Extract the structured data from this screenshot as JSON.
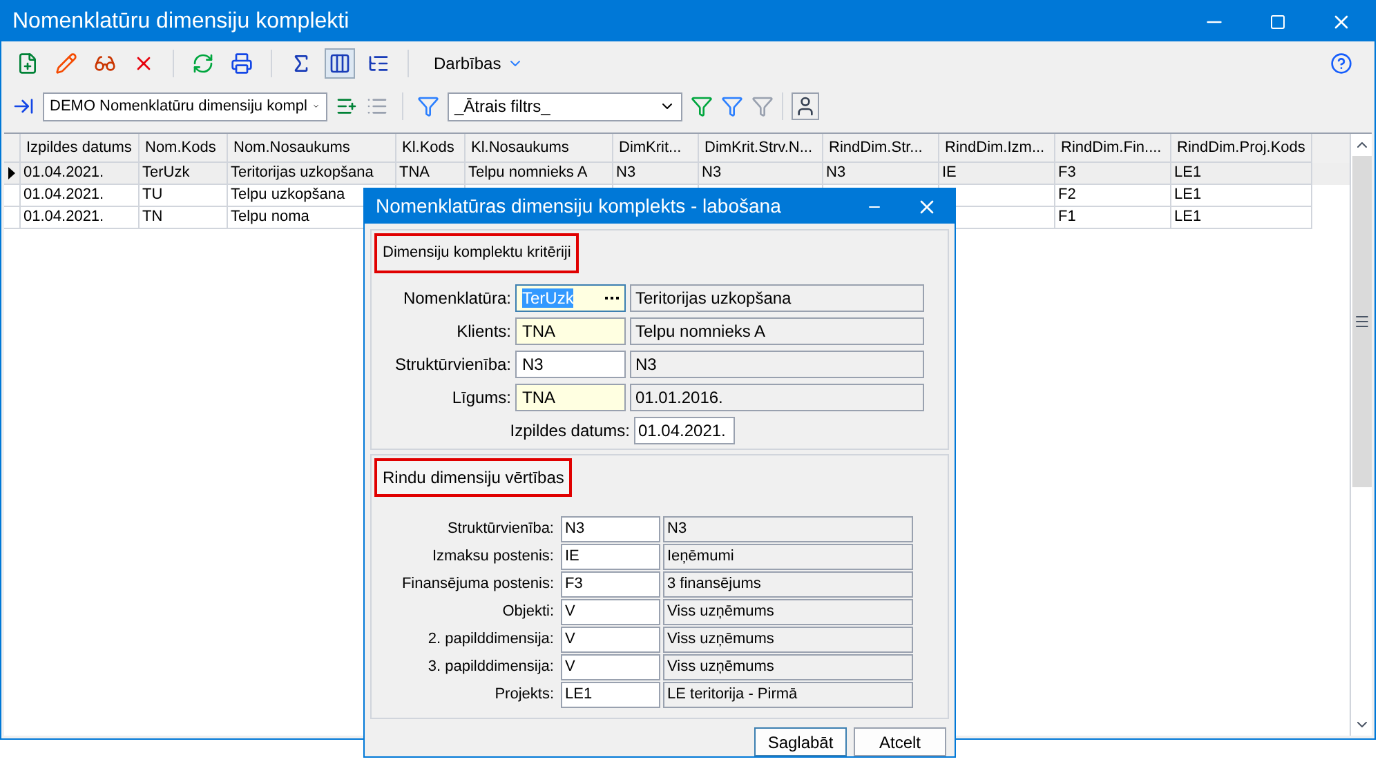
{
  "window": {
    "title": "Nomenklatūru dimensiju komplekti"
  },
  "toolbar": {
    "buttons": [
      {
        "kind": "new",
        "pressed": false
      },
      {
        "kind": "edit",
        "pressed": false
      },
      {
        "kind": "view",
        "pressed": false
      },
      {
        "kind": "delete",
        "pressed": false
      },
      {
        "kind": "sep"
      },
      {
        "kind": "refresh",
        "pressed": false
      },
      {
        "kind": "print",
        "pressed": false
      },
      {
        "kind": "sep"
      },
      {
        "kind": "sum",
        "pressed": false
      },
      {
        "kind": "columns",
        "pressed": true
      },
      {
        "kind": "tree",
        "pressed": false
      },
      {
        "kind": "sep"
      }
    ],
    "menu": "Darbības"
  },
  "filter_bar": {
    "layout": "DEMO Nomenklatūru dimensiju kompl",
    "quick_filter": "_Ātrais filtrs_"
  },
  "table": {
    "columns": [
      "Izpildes datums",
      "Nom.Kods",
      "Nom.Nosaukums",
      "Kl.Kods",
      "Kl.Nosaukums",
      "DimKrit...",
      "DimKrit.Strv.N...",
      "RindDim.Str...",
      "RindDim.Izm...",
      "RindDim.Fin....",
      "RindDim.Proj.Kods"
    ],
    "rows": [
      {
        "selected": true,
        "cells": [
          "01.04.2021.",
          "TerUzk",
          "Teritorijas uzkopšana",
          "TNA",
          "Telpu nomnieks A",
          "N3",
          "N3",
          "N3",
          "IE",
          "F3",
          "LE1"
        ]
      },
      {
        "selected": false,
        "cells": [
          "01.04.2021.",
          "TU",
          "Telpu uzkopšana",
          null,
          null,
          null,
          null,
          null,
          null,
          "F2",
          "LE1"
        ]
      },
      {
        "selected": false,
        "cells": [
          "01.04.2021.",
          "TN",
          "Telpu noma",
          null,
          null,
          null,
          null,
          null,
          null,
          "F1",
          "LE1"
        ]
      }
    ]
  },
  "dialog": {
    "title": "Nomenklatūras dimensiju komplekts - labošana",
    "section_1": {
      "title": "Dimensiju komplektu kritēriji",
      "fields": [
        {
          "label": "Nomenklatūra:",
          "code": "TerUzk",
          "name": "Teritorijas uzkopšana",
          "required": true,
          "focused": true
        },
        {
          "label": "Klients:",
          "code": "TNA",
          "name": "Telpu nomnieks A",
          "required": true,
          "focused": false
        },
        {
          "label": "Struktūrvienība:",
          "code": "N3",
          "name": "N3",
          "required": false,
          "focused": false
        },
        {
          "label": "Līgums:",
          "code": "TNA",
          "name": "01.01.2016.",
          "required": true,
          "focused": false
        }
      ],
      "date_label": "Izpildes datums:",
      "date": "01.04.2021."
    },
    "section_2": {
      "title": "Rindu dimensiju vērtības",
      "fields": [
        {
          "label": "Struktūrvienība:",
          "code": "N3",
          "name": "N3"
        },
        {
          "label": "Izmaksu postenis:",
          "code": "IE",
          "name": "Ieņēmumi"
        },
        {
          "label": "Finansējuma postenis:",
          "code": "F3",
          "name": "3 finansējums"
        },
        {
          "label": "Objekti:",
          "code": "V",
          "name": "Viss uzņēmums"
        },
        {
          "label": "2. papilddimensija:",
          "code": "V",
          "name": "Viss uzņēmums"
        },
        {
          "label": "3. papilddimensija:",
          "code": "V",
          "name": "Viss uzņēmums"
        },
        {
          "label": "Projekts:",
          "code": "LE1",
          "name": "LE teritorija - Pirmā"
        }
      ]
    },
    "buttons": [
      "Saglabāt",
      "Atcelt"
    ]
  }
}
